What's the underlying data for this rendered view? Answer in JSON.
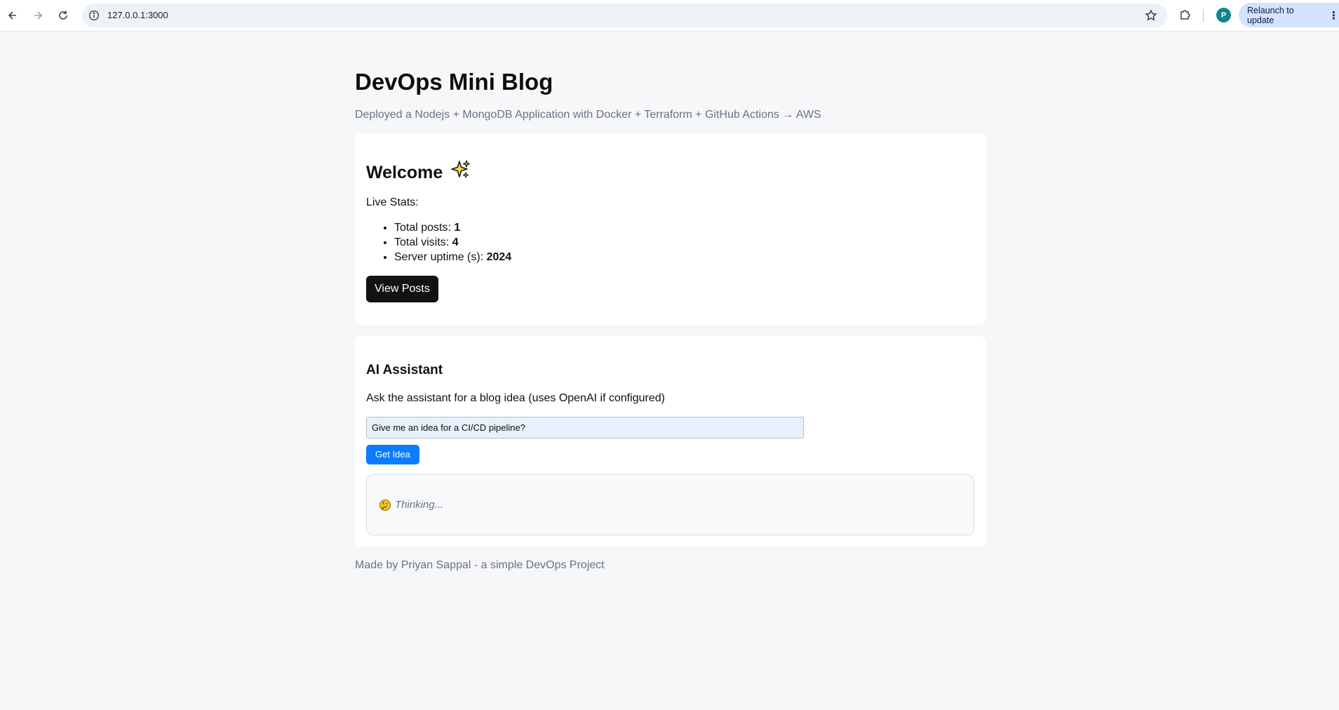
{
  "browser": {
    "url": "127.0.0.1:3000",
    "profile_initial": "P",
    "relaunch_label": "Relaunch to update",
    "kebab": "⋮"
  },
  "page": {
    "title": "DevOps Mini Blog",
    "subtitle": "Deployed a Nodejs + MongoDB Application with Docker + Terraform + GitHub Actions → AWS"
  },
  "welcome": {
    "heading": "Welcome",
    "heading_icon": "sparkles-icon",
    "stats_label": "Live Stats:",
    "stats": [
      {
        "label": "Total posts: ",
        "value": "1"
      },
      {
        "label": "Total visits: ",
        "value": "4"
      },
      {
        "label": "Server uptime (s): ",
        "value": "2024"
      }
    ],
    "view_posts_label": "View Posts"
  },
  "ai": {
    "heading": "AI Assistant",
    "description": "Ask the assistant for a blog idea (uses OpenAI if configured)",
    "input_value": "Give me an idea for a CI/CD pipeline?",
    "button_label": "Get Idea",
    "response_icon": "thinking-face-icon",
    "response_text": "Thinking..."
  },
  "footer": {
    "text": "Made by Priyan Sappal - a simple DevOps Project"
  },
  "colors": {
    "background": "#f6f7f9",
    "card": "#ffffff",
    "primary_button": "#0a7cff",
    "dark_button": "#121212",
    "muted_text": "#6b7280"
  }
}
